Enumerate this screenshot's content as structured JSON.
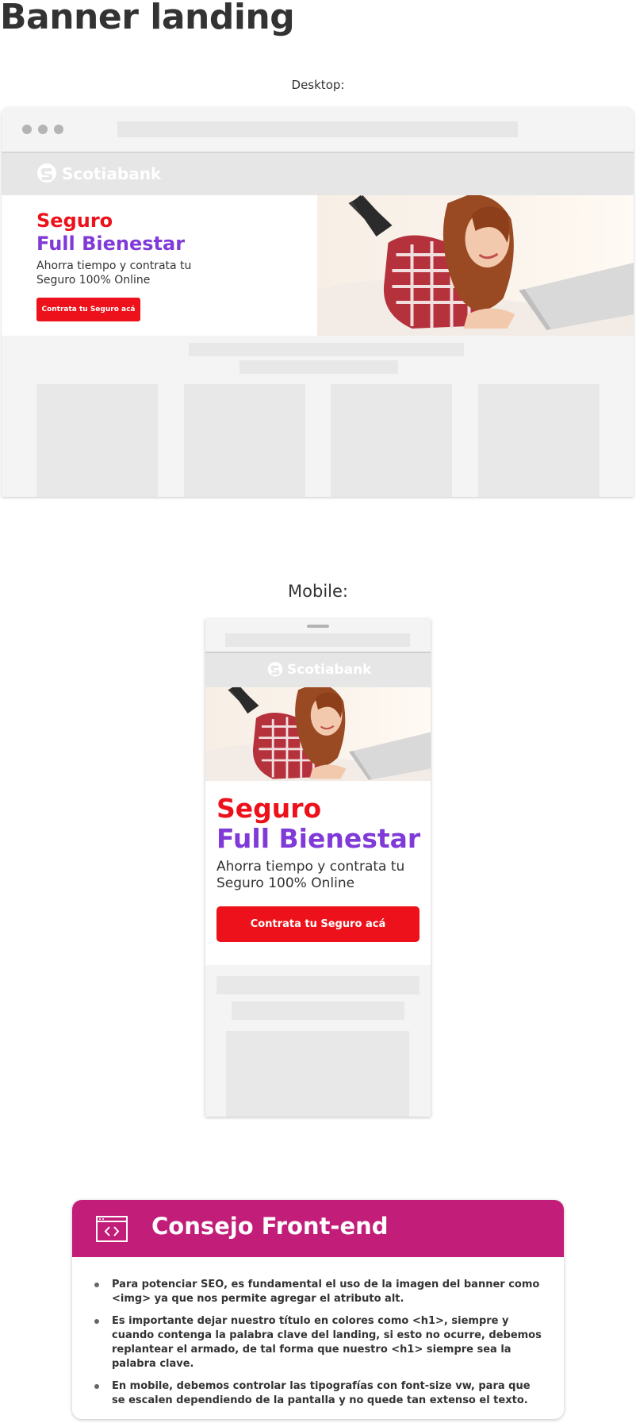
{
  "page": {
    "title": "Banner landing"
  },
  "desktop": {
    "caption": "Desktop:",
    "logo_text": "Scotiabank",
    "banner": {
      "title_line1": "Seguro",
      "title_line2": "Full Bienestar",
      "subtitle": "Ahorra tiempo y contrata tu Seguro 100% Online",
      "cta_label": "Contrata tu Seguro acá"
    }
  },
  "mobile": {
    "caption": "Mobile:",
    "logo_text": "Scotiabank",
    "banner": {
      "title_line1": "Seguro",
      "title_line2": "Full Bienestar",
      "subtitle": "Ahorra tiempo y contrata tu Seguro 100% Online",
      "cta_label": "Contrata tu Seguro acá"
    }
  },
  "tip": {
    "title": "Consejo Front-end",
    "items": [
      "Para potenciar SEO, es fundamental el uso de la imagen del banner como <img> ya que nos permite agregar el atributo alt.",
      "Es importante dejar nuestro título en colores como <h1>, siempre y cuando contenga la palabra clave del landing, si esto no ocurre, debemos replantear el armado, de tal forma que nuestro <h1> siempre sea la palabra clave.",
      "En mobile, debemos controlar las tipografías con font-size vw, para que se escalen dependiendo de la pantalla y no quede tan extenso el texto."
    ]
  },
  "colors": {
    "brand_red": "#ec111a",
    "brand_purple": "#7f3ad8",
    "tip_magenta": "#c21d79",
    "placeholder_gray": "#e8e8e8"
  },
  "icons": [
    "scotiabank-logo-icon",
    "code-window-icon"
  ]
}
